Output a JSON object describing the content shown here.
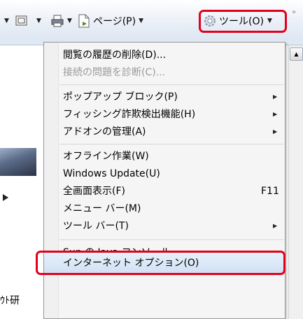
{
  "toolbar": {
    "page_label": "ページ(P)",
    "tools_label": "ツール(O)"
  },
  "page": {
    "cut_text": "ｳﾄ研"
  },
  "menu": {
    "items": [
      {
        "label": "閲覧の履歴の削除(D)...",
        "disabled": false
      },
      {
        "label": "接続の問題を診断(C)...",
        "disabled": true
      },
      {
        "label": "ポップアップ ブロック(P)",
        "submenu": true
      },
      {
        "label": "フィッシング詐欺検出機能(H)",
        "submenu": true
      },
      {
        "label": "アドオンの管理(A)",
        "submenu": true
      },
      {
        "label": "オフライン作業(W)"
      },
      {
        "label": "Windows Update(U)"
      },
      {
        "label": "全画面表示(F)",
        "shortcut": "F11"
      },
      {
        "label": "メニュー バー(M)"
      },
      {
        "label": "ツール バー(T)",
        "submenu": true
      },
      {
        "label": "Sun の Java コンソール"
      },
      {
        "label": "インターネット オプション(O)",
        "highlighted": true
      }
    ]
  },
  "colors": {
    "highlight_red": "#e2001a",
    "menu_bg": "#f5f5f5"
  }
}
